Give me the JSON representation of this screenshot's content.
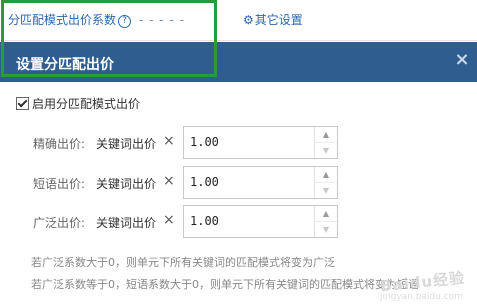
{
  "topbar": {
    "match_coefficient_label": "分匹配模式出价系数",
    "help_icon": "?",
    "dashes": "- - - - -",
    "other_settings_icon": "gear-icon",
    "other_settings_label": "其它设置"
  },
  "modal": {
    "title": "设置分匹配出价",
    "close_icon": "close-icon",
    "close_glyph": "×",
    "enable_label": "启用分匹配模式出价",
    "rows": [
      {
        "label": "精确出价:",
        "type": "关键词出价",
        "times": "×",
        "value": "1.00"
      },
      {
        "label": "短语出价:",
        "type": "关键词出价",
        "times": "×",
        "value": "1.00"
      },
      {
        "label": "广泛出价:",
        "type": "关键词出价",
        "times": "×",
        "value": "1.00"
      }
    ],
    "notes": [
      "若广泛系数大于0，则单元下所有关键词的匹配模式将变为广泛",
      "若广泛系数等于0，短语系数大于0，则单元下所有关键词的匹配模式将变为短语"
    ]
  },
  "colors": {
    "header_bg": "#2f5d90",
    "highlight": "#2a9b3a",
    "link": "#2a67b1"
  },
  "watermark": {
    "text": "Baidu经验",
    "sub": "jingyan.baidu.com"
  }
}
